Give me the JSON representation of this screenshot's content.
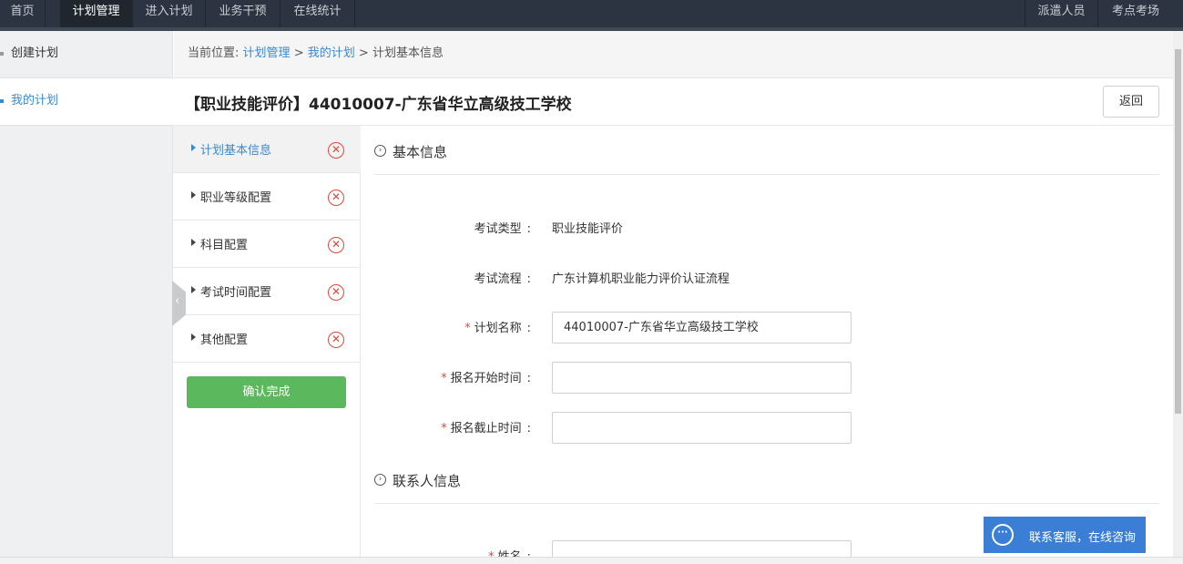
{
  "topnav": {
    "items": [
      "首页",
      "计划管理",
      "进入计划",
      "业务干预",
      "在线统计"
    ],
    "right_items": [
      "派遣人员",
      "考点考场"
    ]
  },
  "sidebar": {
    "items": [
      "创建计划",
      "我的计划"
    ]
  },
  "breadcrumb": {
    "prefix": "当前位置:",
    "links": [
      "计划管理",
      "我的计划"
    ],
    "current": "计划基本信息",
    "sep": ">"
  },
  "page": {
    "title": "【职业技能评价】44010007-广东省华立高级技工学校",
    "back_label": "返回"
  },
  "steps": {
    "items": [
      "计划基本信息",
      "职业等级配置",
      "科目配置",
      "考试时间配置",
      "其他配置"
    ],
    "status_icon": "x-circle-icon",
    "confirm_label": "确认完成"
  },
  "form": {
    "basic_section": "基本信息",
    "fields": {
      "exam_type_label": "考试类型",
      "exam_type_value": "职业技能评价",
      "exam_flow_label": "考试流程",
      "exam_flow_value": "广东计算机职业能力评价认证流程",
      "plan_name_label": "计划名称",
      "plan_name_value": "44010007-广东省华立高级技工学校",
      "reg_start_label": "报名开始时间",
      "reg_start_value": "",
      "reg_end_label": "报名截止时间",
      "reg_end_value": ""
    },
    "contact_section": "联系人信息",
    "contact_name_label": "姓名",
    "contact_name_value": "",
    "colon": ":"
  },
  "chat": {
    "label": "联系客服，在线咨询"
  },
  "colors": {
    "nav_bg": "#2b3440",
    "link": "#3a89d0",
    "confirm": "#5cb85c",
    "error": "#e0483b",
    "chat": "#3a7fd5"
  }
}
